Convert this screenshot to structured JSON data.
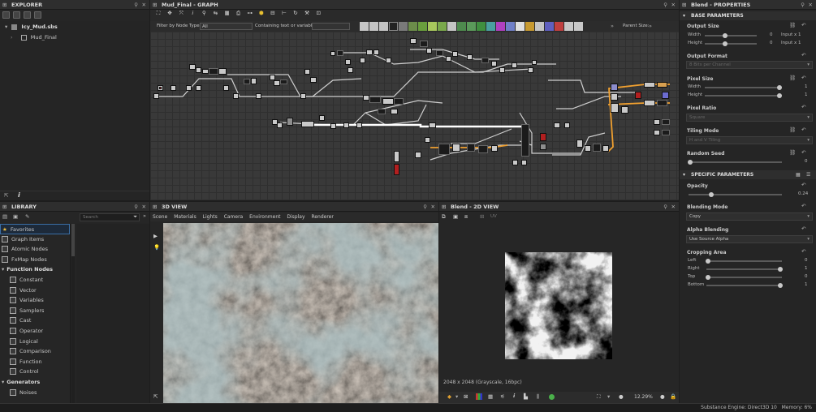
{
  "explorer": {
    "title": "EXPLORER",
    "package": "Icy_Mud.sbs",
    "graph": "Mud_Final"
  },
  "graph": {
    "title": "Mud_Final - GRAPH",
    "filter_label": "Filter by Node Type",
    "filter_value": "All",
    "text_label": "Containing text or variable",
    "parent_size_label": "Parent Size:"
  },
  "library": {
    "title": "LIBRARY",
    "search_placeholder": "Search",
    "items": [
      {
        "label": "Favorites",
        "icon": "star-icon"
      },
      {
        "label": "Graph Items",
        "icon": "graph-icon"
      },
      {
        "label": "Atomic Nodes",
        "icon": "atom-icon"
      },
      {
        "label": "FxMap Nodes",
        "icon": "fxmap-icon"
      },
      {
        "label": "Function Nodes",
        "icon": "function-icon"
      },
      {
        "label": "Constant",
        "icon": "constant-icon"
      },
      {
        "label": "Vector",
        "icon": "vector-icon"
      },
      {
        "label": "Variables",
        "icon": "variables-icon"
      },
      {
        "label": "Samplers",
        "icon": "samplers-icon"
      },
      {
        "label": "Cast",
        "icon": "cast-icon"
      },
      {
        "label": "Operator",
        "icon": "operator-icon"
      },
      {
        "label": "Logical",
        "icon": "logical-icon"
      },
      {
        "label": "Comparison",
        "icon": "comparison-icon"
      },
      {
        "label": "Function",
        "icon": "function-icon"
      },
      {
        "label": "Control",
        "icon": "control-icon"
      },
      {
        "label": "Generators",
        "icon": "generators-icon"
      },
      {
        "label": "Noises",
        "icon": "noises-icon"
      }
    ]
  },
  "view3d": {
    "title": "3D VIEW",
    "menu": [
      "Scene",
      "Materials",
      "Lights",
      "Camera",
      "Environment",
      "Display",
      "Renderer"
    ]
  },
  "view2d": {
    "title": "Blend - 2D VIEW",
    "channel": "UV",
    "info": "2048 x 2048 (Grayscale, 16bpc)",
    "zoom": "12.29%"
  },
  "properties": {
    "title": "Blend - PROPERTIES",
    "base_header": "BASE PARAMETERS",
    "output_size": {
      "label": "Output Size",
      "width_label": "Width",
      "height_label": "Height",
      "width_value": "0",
      "height_value": "0",
      "width_mode": "Input x 1",
      "height_mode": "Input x 1"
    },
    "output_format": {
      "label": "Output Format",
      "value": "8 Bits per Channel"
    },
    "pixel_size": {
      "label": "Pixel Size",
      "width_label": "Width",
      "height_label": "Height",
      "width_value": "1",
      "height_value": "1"
    },
    "pixel_ratio": {
      "label": "Pixel Ratio",
      "value": "Square"
    },
    "tiling_mode": {
      "label": "Tiling Mode",
      "value": "H and V Tiling"
    },
    "random_seed": {
      "label": "Random Seed",
      "value": "0"
    },
    "specific_header": "SPECIFIC PARAMETERS",
    "opacity": {
      "label": "Opacity",
      "value": "0.24",
      "level": 0.24
    },
    "blending_mode": {
      "label": "Blending Mode",
      "value": "Copy"
    },
    "alpha_blending": {
      "label": "Alpha Blending",
      "value": "Use Source Alpha"
    },
    "cropping": {
      "label": "Cropping Area",
      "left_label": "Left",
      "left_value": "0",
      "right_label": "Right",
      "right_value": "1",
      "top_label": "Top",
      "top_value": "0",
      "bottom_label": "Bottom",
      "bottom_value": "1"
    }
  },
  "status": {
    "text": "Substance Engine: Direct3D 10   Memory: 6%"
  },
  "colors": {
    "accent": "#f0a030",
    "panel": "#252525",
    "title": "#2e2e2e",
    "node_red": "#b21f1f"
  }
}
